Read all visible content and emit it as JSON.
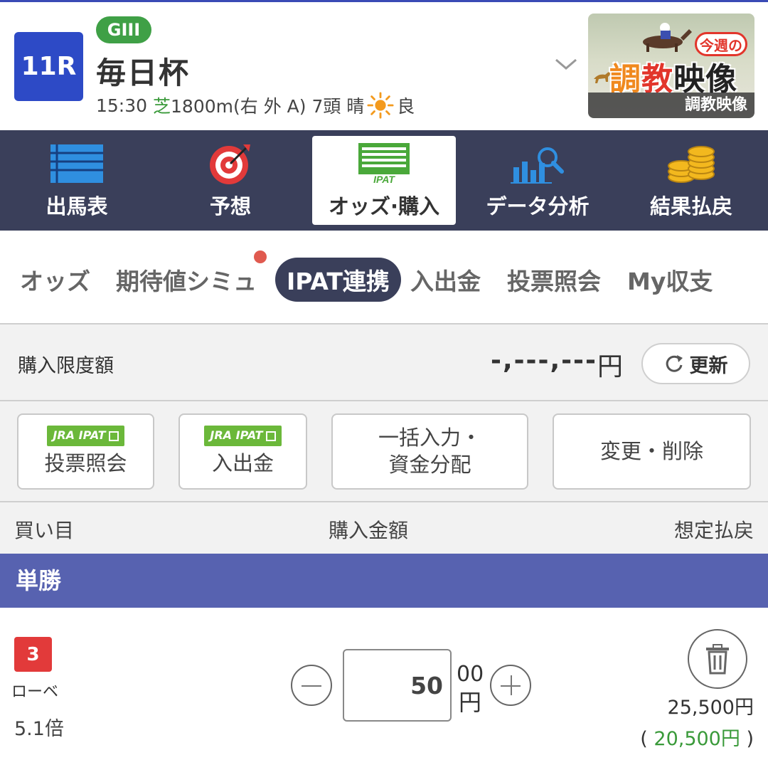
{
  "race": {
    "number": "11R",
    "grade": "GIII",
    "name": "毎日杯",
    "time": "15:30",
    "surface": "芝",
    "details": "1800m(右 外 A) 7頭 晴",
    "condition": "良"
  },
  "banner": {
    "badge": "今週の",
    "title_1": "調",
    "title_2": "教",
    "title_3": "映像",
    "caption": "調教映像"
  },
  "main_nav": [
    {
      "label": "出馬表",
      "icon": "race-card-icon"
    },
    {
      "label": "予想",
      "icon": "target-icon"
    },
    {
      "label": "オッズ·購入",
      "icon": "ipat-icon",
      "sub": "IPAT"
    },
    {
      "label": "データ分析",
      "icon": "chart-search-icon"
    },
    {
      "label": "結果払戻",
      "icon": "coins-icon"
    }
  ],
  "subtabs": [
    {
      "label": "オッズ"
    },
    {
      "label": "期待値シミュ"
    },
    {
      "label": "IPAT連携"
    },
    {
      "label": "入出金"
    },
    {
      "label": "投票照会"
    },
    {
      "label": "My収支"
    }
  ],
  "limit": {
    "label": "購入限度額",
    "value": "-,---,---",
    "unit": "円",
    "refresh": "更新"
  },
  "actions": {
    "jra_badge": "JRA IPAT",
    "inquiry": "投票照会",
    "deposit": "入出金",
    "bulk_line1": "一括入力・",
    "bulk_line2": "資金分配",
    "edit": "変更・削除"
  },
  "columns": {
    "bet": "買い目",
    "amount": "購入金額",
    "payout": "想定払戻"
  },
  "bet_type": "単勝",
  "bet": {
    "horse_number": "3",
    "horse_name": "ローベ",
    "odds": "5.1倍",
    "amount": "50",
    "suffix_00": "00",
    "suffix_yen": "円",
    "payout": "25,500円",
    "profit_open": "( ",
    "profit": "20,500円",
    "profit_close": " )"
  },
  "colors": {
    "nav_bg": "#3a3f5a",
    "race_badge": "#2d4ac6",
    "grade_badge": "#3fa046",
    "bet_band": "#5762b0",
    "horse_badge": "#e23a3a",
    "profit_green": "#3a9a3a"
  }
}
